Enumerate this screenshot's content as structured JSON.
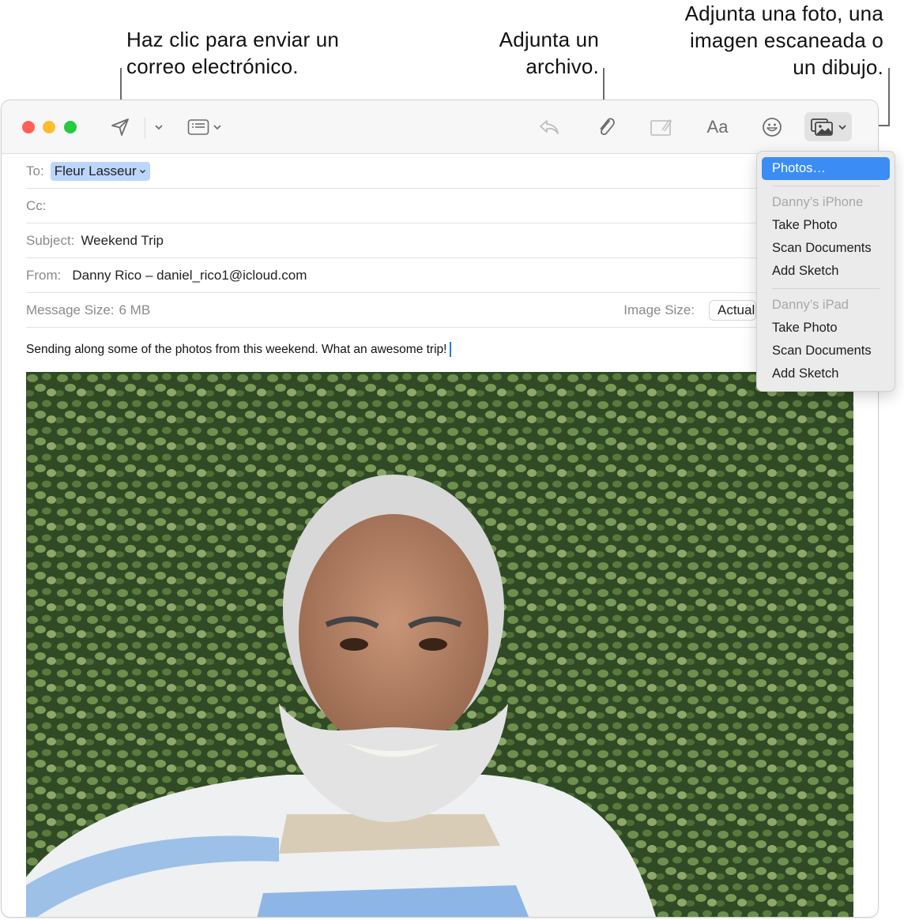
{
  "callouts": {
    "send": [
      "Haz clic para enviar un",
      "correo electrónico."
    ],
    "attach": [
      "Adjunta un",
      "archivo."
    ],
    "photo": [
      "Adjunta una foto, una",
      "imagen escaneada o",
      "un dibujo."
    ]
  },
  "toolbar": {
    "icons": [
      "send-icon",
      "send-options-chevron",
      "header-fields-icon",
      "reply-icon",
      "attachment-icon",
      "markup-icon",
      "format-icon",
      "emoji-icon",
      "photo-browser-icon"
    ],
    "format_label": "Aa"
  },
  "colors": {
    "close": "#ff5f57",
    "minimize": "#febc2e",
    "zoom": "#28c840",
    "accent": "#3b8cf5",
    "token": "#bcd6fb"
  },
  "headers": {
    "to_label": "To:",
    "to_value": "Fleur Lasseur",
    "cc_label": "Cc:",
    "cc_value": "",
    "subject_label": "Subject:",
    "subject_value": "Weekend Trip",
    "from_label": "From:",
    "from_value": "Danny Rico – daniel_rico1@icloud.com",
    "message_size_label": "Message Size:",
    "message_size_value": "6 MB",
    "image_size_label": "Image Size:",
    "image_size_value": "Actual Size"
  },
  "body": {
    "text": "Sending along some of the photos from this weekend. What an awesome trip!"
  },
  "photo": {
    "description": "Selfie of a smiling man with white hair and beard in a striped shirt in front of an ivy-covered wall"
  },
  "menu": {
    "top_item": "Photos…",
    "groups": [
      {
        "header": "Danny’s iPhone",
        "items": [
          "Take Photo",
          "Scan Documents",
          "Add Sketch"
        ]
      },
      {
        "header": "Danny’s iPad",
        "items": [
          "Take Photo",
          "Scan Documents",
          "Add Sketch"
        ]
      }
    ]
  }
}
